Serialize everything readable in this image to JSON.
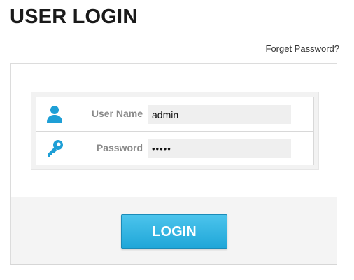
{
  "header": {
    "title": "USER LOGIN"
  },
  "links": {
    "forget_password": "Forget Password?"
  },
  "form": {
    "username": {
      "label": "User Name",
      "value": "admin",
      "icon": "user-icon"
    },
    "password": {
      "label": "Password",
      "value": "•••••",
      "icon": "key-icon"
    }
  },
  "actions": {
    "login_label": "LOGIN"
  },
  "colors": {
    "accent": "#1fa6d8",
    "icon": "#1e9fd6"
  }
}
